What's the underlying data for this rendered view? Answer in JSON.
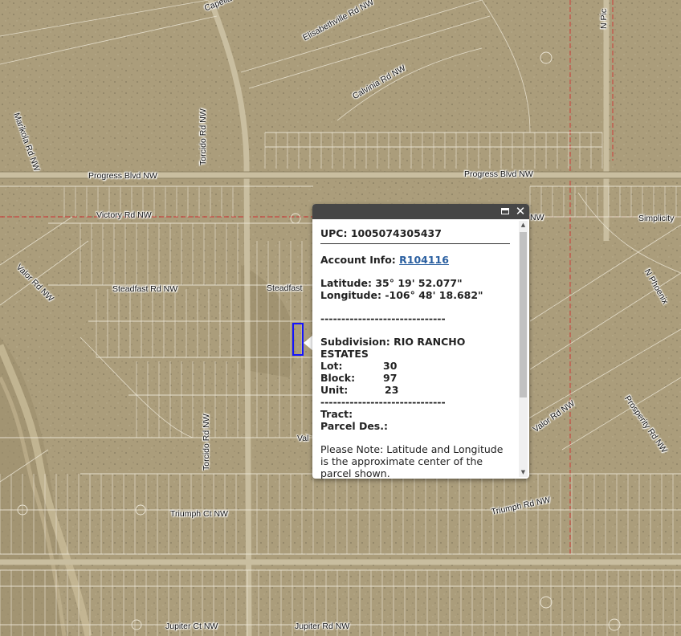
{
  "map": {
    "road_labels": [
      {
        "id": "capella",
        "text": "Capella"
      },
      {
        "id": "elisabethville",
        "text": "Elisabethville Rd NW"
      },
      {
        "id": "calvinia",
        "text": "Calvinia Rd NW"
      },
      {
        "id": "marikola",
        "text": "Marikola Rd NW"
      },
      {
        "id": "progress-west",
        "text": "Progress Blvd NW"
      },
      {
        "id": "progress-east",
        "text": "Progress Blvd NW"
      },
      {
        "id": "torcido-north",
        "text": "Torcido Rd NW"
      },
      {
        "id": "torcido-south",
        "text": "Torcido Rd NW"
      },
      {
        "id": "victory",
        "text": "Victory Rd NW"
      },
      {
        "id": "victory-east",
        "text": "NW"
      },
      {
        "id": "simplicity",
        "text": "Simplicity"
      },
      {
        "id": "valor-west",
        "text": "Valor Rd NW"
      },
      {
        "id": "steadfast-west",
        "text": "Steadfast Rd NW"
      },
      {
        "id": "steadfast-mid",
        "text": "Steadfast"
      },
      {
        "id": "n-phoenix",
        "text": "N Phoenix"
      },
      {
        "id": "prosperity",
        "text": "Prosperity Rd NW"
      },
      {
        "id": "valor-east",
        "text": "Valor Rd NW"
      },
      {
        "id": "valor-mid",
        "text": "Val"
      },
      {
        "id": "triumph-west",
        "text": "Triumph Ct NW"
      },
      {
        "id": "triumph-east",
        "text": "Triumph Rd NW"
      },
      {
        "id": "jupiter-ct",
        "text": "Jupiter Ct NW"
      },
      {
        "id": "jupiter-rd",
        "text": "Jupiter Rd NW"
      },
      {
        "id": "n-pic",
        "text": "N Pic"
      }
    ]
  },
  "popup": {
    "upc_label": "UPC:",
    "upc_value": "1005074305437",
    "account_label": "Account Info:",
    "account_value": "R104116",
    "latitude_label": "Latitude:",
    "latitude_value": "35° 19' 52.077\"",
    "longitude_label": "Longitude:",
    "longitude_value": "-106° 48' 18.682\"",
    "separator": "------------------------------",
    "subdivision_label": "Subdivision:",
    "subdivision_value": "RIO RANCHO ESTATES",
    "lot_label": "Lot:",
    "lot_value": "30",
    "block_label": "Block:",
    "block_value": "97",
    "unit_label": "Unit:",
    "unit_value": "23",
    "tract_label": "Tract:",
    "parcel_des_label": "Parcel Des.:",
    "note": "Please Note: Latitude and Longitude is the approximate center of the parcel shown."
  },
  "icons": {
    "maximize": "maximize-icon",
    "close": "close-icon"
  },
  "colors": {
    "popup_titlebar": "#464646",
    "parcel_highlight": "#1414ff",
    "link": "#2a5fa0"
  }
}
